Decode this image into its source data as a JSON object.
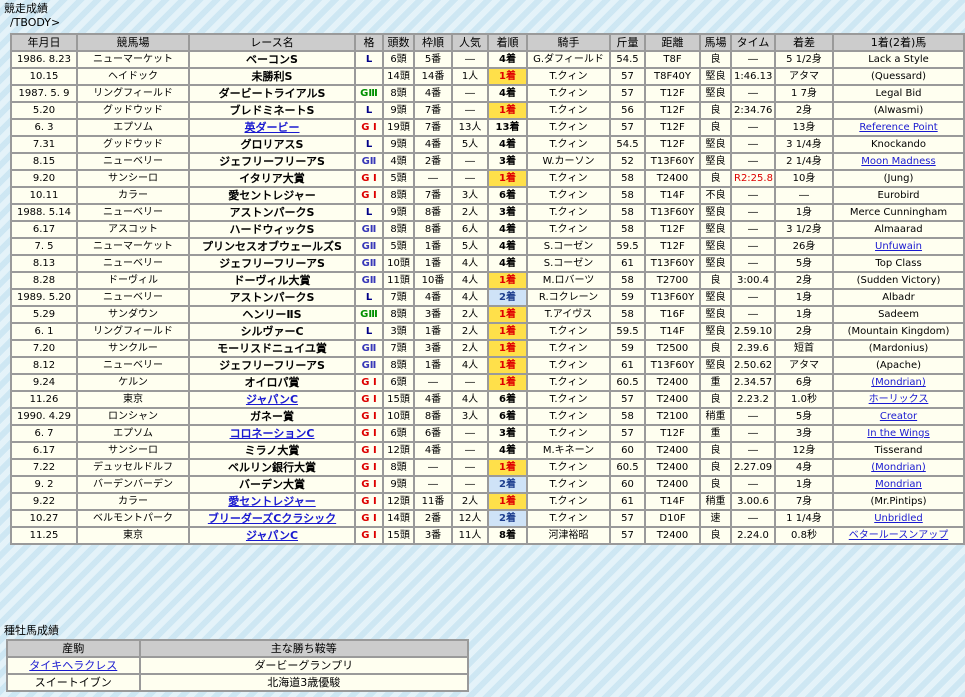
{
  "section_race_title": "競走成績",
  "tbody_label": "/TBODY>",
  "race_headers": [
    "年月日",
    "競馬場",
    "レース名",
    "格",
    "頭数",
    "枠順",
    "人気",
    "着順",
    "騎手",
    "斤量",
    "距離",
    "馬場",
    "タイム",
    "着差",
    "1着(2着)馬"
  ],
  "races": [
    {
      "date": "1986. 8.23",
      "course": "ニューマーケット",
      "race": "ベーコンS",
      "race_link": false,
      "grade": "L",
      "grade_class": "L",
      "field": "6頭",
      "post": "5番",
      "pop": "―",
      "finish": "4着",
      "finish_type": "other",
      "jockey": "G.ダフィールド",
      "weight": "54.5",
      "distance": "T8F",
      "going": "良",
      "time": "―",
      "margin": "5 1/2身",
      "winner": "Lack a Style",
      "winner_link": false
    },
    {
      "date": "10.15",
      "course": "ヘイドック",
      "race": "未勝利S",
      "race_link": false,
      "grade": "",
      "grade_class": "",
      "field": "14頭",
      "post": "14番",
      "pop": "1人",
      "finish": "1着",
      "finish_type": "win",
      "jockey": "T.クィン",
      "weight": "57",
      "distance": "T8F40Y",
      "going": "堅良",
      "time": "1:46.13",
      "margin": "アタマ",
      "winner": "(Quessard)",
      "winner_link": false
    },
    {
      "date": "1987. 5. 9",
      "course": "リングフィールド",
      "race": "ダービートライアルS",
      "race_link": false,
      "grade": "GⅢ",
      "grade_class": "G3",
      "field": "8頭",
      "post": "4番",
      "pop": "―",
      "finish": "4着",
      "finish_type": "other",
      "jockey": "T.クィン",
      "weight": "57",
      "distance": "T12F",
      "going": "堅良",
      "time": "―",
      "margin": "1 7身",
      "winner": "Legal Bid",
      "winner_link": false
    },
    {
      "date": "5.20",
      "course": "グッドウッド",
      "race": "ブレドミネートS",
      "race_link": false,
      "grade": "L",
      "grade_class": "L",
      "field": "9頭",
      "post": "7番",
      "pop": "―",
      "finish": "1着",
      "finish_type": "win",
      "jockey": "T.クィン",
      "weight": "56",
      "distance": "T12F",
      "going": "良",
      "time": "2:34.76",
      "margin": "2身",
      "winner": "(Alwasmi)",
      "winner_link": false
    },
    {
      "date": "6. 3",
      "course": "エプソム",
      "race": "英ダービー",
      "race_link": true,
      "grade": "G I",
      "grade_class": "G1",
      "field": "19頭",
      "post": "7番",
      "pop": "13人",
      "finish": "13着",
      "finish_type": "other",
      "jockey": "T.クィン",
      "weight": "57",
      "distance": "T12F",
      "going": "良",
      "time": "―",
      "margin": "13身",
      "winner": "Reference Point",
      "winner_link": true
    },
    {
      "date": "7.31",
      "course": "グッドウッド",
      "race": "グロリアスS",
      "race_link": false,
      "grade": "L",
      "grade_class": "L",
      "field": "9頭",
      "post": "4番",
      "pop": "5人",
      "finish": "4着",
      "finish_type": "other",
      "jockey": "T.クィン",
      "weight": "54.5",
      "distance": "T12F",
      "going": "堅良",
      "time": "―",
      "margin": "3 1/4身",
      "winner": "Knockando",
      "winner_link": false
    },
    {
      "date": "8.15",
      "course": "ニューベリー",
      "race": "ジェフリーフリーアS",
      "race_link": false,
      "grade": "GⅡ",
      "grade_class": "G2",
      "field": "4頭",
      "post": "2番",
      "pop": "―",
      "finish": "3着",
      "finish_type": "other",
      "jockey": "W.カーソン",
      "weight": "52",
      "distance": "T13F60Y",
      "going": "堅良",
      "time": "―",
      "margin": "2 1/4身",
      "winner": "Moon Madness",
      "winner_link": true
    },
    {
      "date": "9.20",
      "course": "サンシーロ",
      "race": "イタリア大賞",
      "race_link": false,
      "grade": "G I",
      "grade_class": "G1",
      "field": "5頭",
      "post": "―",
      "pop": "―",
      "finish": "1着",
      "finish_type": "win",
      "jockey": "T.クィン",
      "weight": "58",
      "distance": "T2400",
      "going": "良",
      "time": "R2:25.8",
      "time_record": true,
      "margin": "10身",
      "winner": "(Jung)",
      "winner_link": false
    },
    {
      "date": "10.11",
      "course": "カラー",
      "race": "愛セントレジャー",
      "race_link": false,
      "grade": "G I",
      "grade_class": "G1",
      "field": "8頭",
      "post": "7番",
      "pop": "3人",
      "finish": "6着",
      "finish_type": "other",
      "jockey": "T.クィン",
      "weight": "58",
      "distance": "T14F",
      "going": "不良",
      "time": "―",
      "margin": "―",
      "winner": "Eurobird",
      "winner_link": false
    },
    {
      "date": "1988. 5.14",
      "course": "ニューベリー",
      "race": "アストンパークS",
      "race_link": false,
      "grade": "L",
      "grade_class": "L",
      "field": "9頭",
      "post": "8番",
      "pop": "2人",
      "finish": "3着",
      "finish_type": "other",
      "jockey": "T.クィン",
      "weight": "58",
      "distance": "T13F60Y",
      "going": "堅良",
      "time": "―",
      "margin": "1身",
      "winner": "Merce Cunningham",
      "winner_link": false
    },
    {
      "date": "6.17",
      "course": "アスコット",
      "race": "ハードウィックS",
      "race_link": false,
      "grade": "GⅡ",
      "grade_class": "G2",
      "field": "8頭",
      "post": "8番",
      "pop": "6人",
      "finish": "4着",
      "finish_type": "other",
      "jockey": "T.クィン",
      "weight": "58",
      "distance": "T12F",
      "going": "堅良",
      "time": "―",
      "margin": "3 1/2身",
      "winner": "Almaarad",
      "winner_link": false
    },
    {
      "date": "7. 5",
      "course": "ニューマーケット",
      "race": "プリンセスオブウェールズS",
      "race_link": false,
      "grade": "GⅡ",
      "grade_class": "G2",
      "field": "5頭",
      "post": "1番",
      "pop": "5人",
      "finish": "4着",
      "finish_type": "other",
      "jockey": "S.コーゼン",
      "weight": "59.5",
      "distance": "T12F",
      "going": "堅良",
      "time": "―",
      "margin": "26身",
      "winner": "Unfuwain",
      "winner_link": true
    },
    {
      "date": "8.13",
      "course": "ニューベリー",
      "race": "ジェフリーフリーアS",
      "race_link": false,
      "grade": "GⅡ",
      "grade_class": "G2",
      "field": "10頭",
      "post": "1番",
      "pop": "4人",
      "finish": "4着",
      "finish_type": "other",
      "jockey": "S.コーゼン",
      "weight": "61",
      "distance": "T13F60Y",
      "going": "堅良",
      "time": "―",
      "margin": "5身",
      "winner": "Top Class",
      "winner_link": false
    },
    {
      "date": "8.28",
      "course": "ドーヴィル",
      "race": "ドーヴィル大賞",
      "race_link": false,
      "grade": "GⅡ",
      "grade_class": "G2",
      "field": "11頭",
      "post": "10番",
      "pop": "4人",
      "finish": "1着",
      "finish_type": "win",
      "jockey": "M.ロバーツ",
      "weight": "58",
      "distance": "T2700",
      "going": "良",
      "time": "3:00.4",
      "margin": "2身",
      "winner": "(Sudden Victory)",
      "winner_link": false
    },
    {
      "date": "1989. 5.20",
      "course": "ニューベリー",
      "race": "アストンパークS",
      "race_link": false,
      "grade": "L",
      "grade_class": "L",
      "field": "7頭",
      "post": "4番",
      "pop": "4人",
      "finish": "2着",
      "finish_type": "second",
      "jockey": "R.コクレーン",
      "weight": "59",
      "distance": "T13F60Y",
      "going": "堅良",
      "time": "―",
      "margin": "1身",
      "winner": "Albadr",
      "winner_link": false
    },
    {
      "date": "5.29",
      "course": "サンダウン",
      "race": "ヘンリーⅡS",
      "race_link": false,
      "grade": "GⅢ",
      "grade_class": "G3",
      "field": "8頭",
      "post": "3番",
      "pop": "2人",
      "finish": "1着",
      "finish_type": "win",
      "jockey": "T.アイヴス",
      "weight": "58",
      "distance": "T16F",
      "going": "堅良",
      "time": "―",
      "margin": "1身",
      "winner": "Sadeem",
      "winner_link": false
    },
    {
      "date": "6. 1",
      "course": "リングフィールド",
      "race": "シルヴァーC",
      "race_link": false,
      "grade": "L",
      "grade_class": "L",
      "field": "3頭",
      "post": "1番",
      "pop": "2人",
      "finish": "1着",
      "finish_type": "win",
      "jockey": "T.クィン",
      "weight": "59.5",
      "distance": "T14F",
      "going": "堅良",
      "time": "2.59.10",
      "margin": "2身",
      "winner": "(Mountain Kingdom)",
      "winner_link": false
    },
    {
      "date": "7.20",
      "course": "サンクルー",
      "race": "モーリスドニュイユ賞",
      "race_link": false,
      "grade": "GⅡ",
      "grade_class": "G2",
      "field": "7頭",
      "post": "3番",
      "pop": "2人",
      "finish": "1着",
      "finish_type": "win",
      "jockey": "T.クィン",
      "weight": "59",
      "distance": "T2500",
      "going": "良",
      "time": "2.39.6",
      "margin": "短首",
      "winner": "(Mardonius)",
      "winner_link": false
    },
    {
      "date": "8.12",
      "course": "ニューベリー",
      "race": "ジェフリーフリーアS",
      "race_link": false,
      "grade": "GⅡ",
      "grade_class": "G2",
      "field": "8頭",
      "post": "1番",
      "pop": "4人",
      "finish": "1着",
      "finish_type": "win",
      "jockey": "T.クィン",
      "weight": "61",
      "distance": "T13F60Y",
      "going": "堅良",
      "time": "2.50.62",
      "margin": "アタマ",
      "winner": "(Apache)",
      "winner_link": false
    },
    {
      "date": "9.24",
      "course": "ケルン",
      "race": "オイロパ賞",
      "race_link": false,
      "grade": "G I",
      "grade_class": "G1",
      "field": "6頭",
      "post": "―",
      "pop": "―",
      "finish": "1着",
      "finish_type": "win",
      "jockey": "T.クィン",
      "weight": "60.5",
      "distance": "T2400",
      "going": "重",
      "time": "2.34.57",
      "margin": "6身",
      "winner": "(Mondrian)",
      "winner_link": true
    },
    {
      "date": "11.26",
      "course": "東京",
      "race": "ジャパンC",
      "race_link": true,
      "grade": "G I",
      "grade_class": "G1",
      "field": "15頭",
      "post": "4番",
      "pop": "4人",
      "finish": "6着",
      "finish_type": "other",
      "jockey": "T.クィン",
      "weight": "57",
      "distance": "T2400",
      "going": "良",
      "time": "2.23.2",
      "margin": "1.0秒",
      "winner": "ホーリックス",
      "winner_link": true
    },
    {
      "date": "1990. 4.29",
      "course": "ロンシャン",
      "race": "ガネー賞",
      "race_link": false,
      "grade": "G I",
      "grade_class": "G1",
      "field": "10頭",
      "post": "8番",
      "pop": "3人",
      "finish": "6着",
      "finish_type": "other",
      "jockey": "T.クィン",
      "weight": "58",
      "distance": "T2100",
      "going": "稍重",
      "time": "―",
      "margin": "5身",
      "winner": "Creator",
      "winner_link": true
    },
    {
      "date": "6. 7",
      "course": "エプソム",
      "race": "コロネーションC",
      "race_link": true,
      "grade": "G I",
      "grade_class": "G1",
      "field": "6頭",
      "post": "6番",
      "pop": "―",
      "finish": "3着",
      "finish_type": "other",
      "jockey": "T.クィン",
      "weight": "57",
      "distance": "T12F",
      "going": "重",
      "time": "―",
      "margin": "3身",
      "winner": "In the Wings",
      "winner_link": true
    },
    {
      "date": "6.17",
      "course": "サンシーロ",
      "race": "ミラノ大賞",
      "race_link": false,
      "grade": "G I",
      "grade_class": "G1",
      "field": "12頭",
      "post": "4番",
      "pop": "―",
      "finish": "4着",
      "finish_type": "other",
      "jockey": "M.キネーン",
      "weight": "60",
      "distance": "T2400",
      "going": "良",
      "time": "―",
      "margin": "12身",
      "winner": "Tisserand",
      "winner_link": false
    },
    {
      "date": "7.22",
      "course": "デュッセルドルフ",
      "race": "ベルリン銀行大賞",
      "race_link": false,
      "grade": "G I",
      "grade_class": "G1",
      "field": "8頭",
      "post": "―",
      "pop": "―",
      "finish": "1着",
      "finish_type": "win",
      "jockey": "T.クィン",
      "weight": "60.5",
      "distance": "T2400",
      "going": "良",
      "time": "2.27.09",
      "margin": "4身",
      "winner": "(Mondrian)",
      "winner_link": true
    },
    {
      "date": "9. 2",
      "course": "バーデンバーデン",
      "race": "バーデン大賞",
      "race_link": false,
      "grade": "G I",
      "grade_class": "G1",
      "field": "9頭",
      "post": "―",
      "pop": "―",
      "finish": "2着",
      "finish_type": "second",
      "jockey": "T.クィン",
      "weight": "60",
      "distance": "T2400",
      "going": "良",
      "time": "―",
      "margin": "1身",
      "winner": "Mondrian",
      "winner_link": true
    },
    {
      "date": "9.22",
      "course": "カラー",
      "race": "愛セントレジャー",
      "race_link": true,
      "grade": "G I",
      "grade_class": "G1",
      "field": "12頭",
      "post": "11番",
      "pop": "2人",
      "finish": "1着",
      "finish_type": "win",
      "jockey": "T.クィン",
      "weight": "61",
      "distance": "T14F",
      "going": "稍重",
      "time": "3.00.6",
      "margin": "7身",
      "winner": "(Mr.Pintips)",
      "winner_link": false
    },
    {
      "date": "10.27",
      "course": "ベルモントパーク",
      "race": "ブリーダーズCクラシック",
      "race_link": true,
      "grade": "G I",
      "grade_class": "G1",
      "field": "14頭",
      "post": "2番",
      "pop": "12人",
      "finish": "2着",
      "finish_type": "second",
      "jockey": "T.クィン",
      "weight": "57",
      "distance": "D10F",
      "going": "速",
      "time": "―",
      "margin": "1 1/4身",
      "winner": "Unbridled",
      "winner_link": true
    },
    {
      "date": "11.25",
      "course": "東京",
      "race": "ジャパンC",
      "race_link": true,
      "grade": "G I",
      "grade_class": "G1",
      "field": "15頭",
      "post": "3番",
      "pop": "11人",
      "finish": "8着",
      "finish_type": "other",
      "jockey": "河津裕昭",
      "weight": "57",
      "distance": "T2400",
      "going": "良",
      "time": "2.24.0",
      "margin": "0.8秒",
      "winner": "ベタールースンアップ",
      "winner_link": true
    }
  ],
  "section_stud_title": "種牡馬成績",
  "stud_headers": [
    "産駒",
    "主な勝ち鞍等"
  ],
  "stud_rows": [
    {
      "name": "タイキヘラクレス",
      "name_link": true,
      "wins": "ダービーグランプリ"
    },
    {
      "name": "スイートイブン",
      "name_link": false,
      "wins": "北海道3歳優駿"
    }
  ]
}
